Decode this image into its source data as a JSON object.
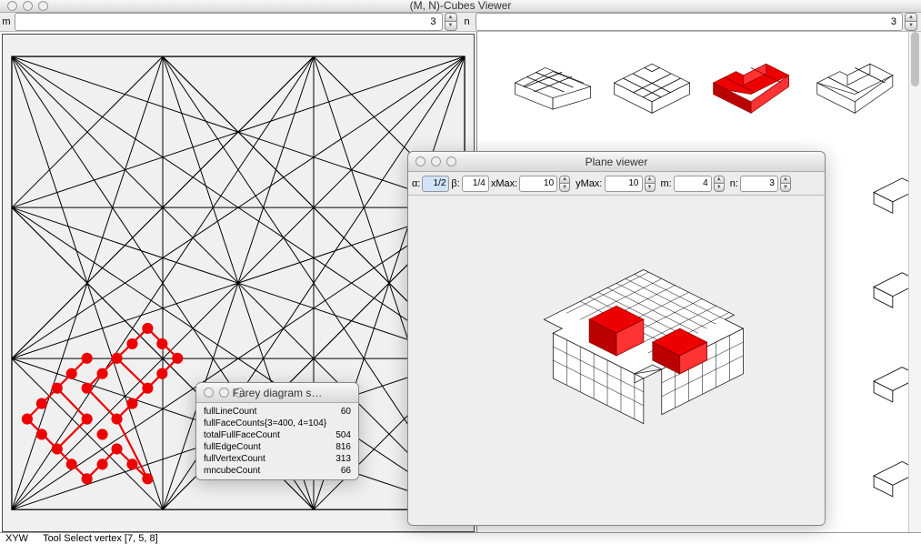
{
  "window": {
    "title": "(M, N)-Cubes Viewer"
  },
  "toolbar": {
    "m_label": "m",
    "m_value": "3",
    "n_label": "n",
    "n_value": "3"
  },
  "status": {
    "xyw": "XYW",
    "tool": "Tool Select vertex [7, 5, 8]"
  },
  "stats_panel": {
    "title": "Farey diagram s…",
    "rows": [
      {
        "k": "fullLineCount",
        "v": "60"
      },
      {
        "k": "fullFaceCounts{3=400, 4=104}",
        "v": ""
      },
      {
        "k": "totalFullFaceCount",
        "v": "504"
      },
      {
        "k": "fullEdgeCount",
        "v": "816"
      },
      {
        "k": "fullVertexCount",
        "v": "313"
      },
      {
        "k": "mncubeCount",
        "v": "66"
      }
    ]
  },
  "plane_panel": {
    "title": "Plane viewer",
    "alpha_label": "α:",
    "alpha_value": "1/2",
    "beta_label": "β:",
    "beta_value": "1/4",
    "xmax_label": "xMax:",
    "xmax_value": "10",
    "ymax_label": "yMax:",
    "ymax_value": "10",
    "m_label": "m:",
    "m_value": "4",
    "n_label": "n:",
    "n_value": "3"
  }
}
